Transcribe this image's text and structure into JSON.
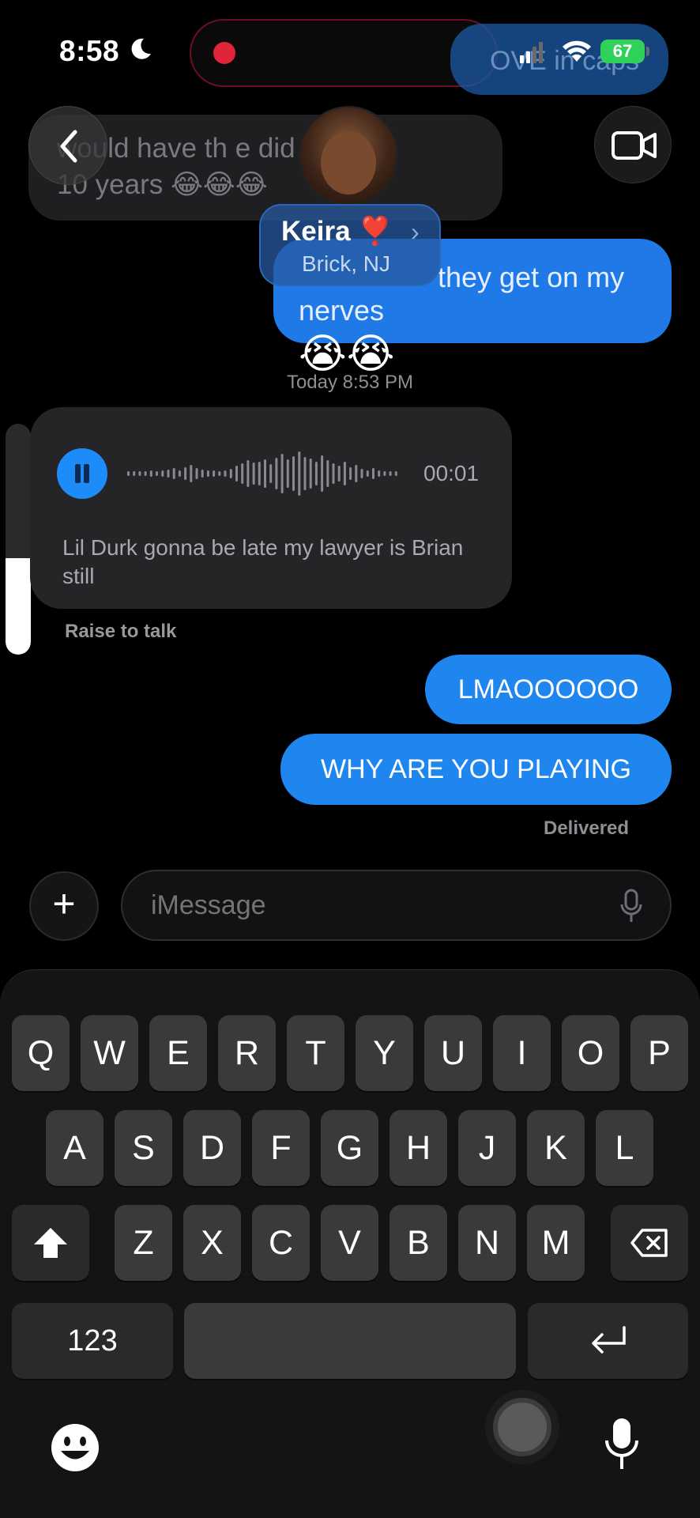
{
  "status_bar": {
    "time": "8:58",
    "battery": "67"
  },
  "thread": {
    "faded_top_right_text": "OVE in caps",
    "faded_top_left_text": "would have th       e did\n10 years 😂😂😂",
    "top_blue_text_line1": "they get on my",
    "top_blue_text_line2": "nerves",
    "top_blue_emoji": "😭😭",
    "timestamp": "Today 8:53 PM"
  },
  "contact": {
    "name": "Keira ❣️",
    "chevron": "›",
    "location": "Brick, NJ"
  },
  "audio_message": {
    "duration": "00:01",
    "transcript": "Lil Durk gonna be late my lawyer is Brian still",
    "hint": "Raise to talk"
  },
  "sent_messages": [
    {
      "text": "LMAOOOOOO"
    },
    {
      "text": "WHY ARE YOU PLAYING"
    }
  ],
  "delivery_status": "Delivered",
  "input": {
    "plus": "+",
    "placeholder": "iMessage"
  },
  "keyboard": {
    "row1": [
      "Q",
      "W",
      "E",
      "R",
      "T",
      "Y",
      "U",
      "I",
      "O",
      "P"
    ],
    "row2": [
      "A",
      "S",
      "D",
      "F",
      "G",
      "H",
      "J",
      "K",
      "L"
    ],
    "row3": [
      "Z",
      "X",
      "C",
      "V",
      "B",
      "N",
      "M"
    ],
    "numbers_key": "123"
  },
  "colors": {
    "sent_bubble": "#1f86f0",
    "received_bubble": "#252527",
    "battery": "#30d158"
  }
}
